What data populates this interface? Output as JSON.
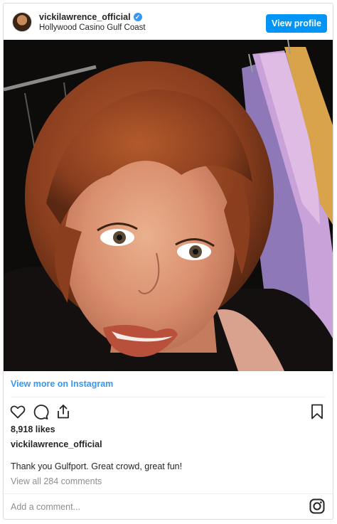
{
  "post": {
    "username": "vickilawrence_official",
    "location": "Hollywood Casino Gulf Coast",
    "view_profile_label": "View profile",
    "view_more_label": "View more on Instagram",
    "likes": "8,918 likes",
    "author": "vickilawrence_official",
    "caption": "Thank you Gulfport. Great crowd, great fun!",
    "view_comments": "View all 284 comments",
    "add_comment_placeholder": "Add a comment..."
  },
  "icons": {
    "like": "heart-icon",
    "comment": "comment-icon",
    "share": "share-icon",
    "save": "bookmark-icon",
    "verified": "verified-badge-icon",
    "instagram": "instagram-logo-icon"
  },
  "colors": {
    "accent": "#0095f6",
    "link": "#3897f0",
    "muted": "#8e8e8e",
    "border": "#dbdbdb"
  }
}
